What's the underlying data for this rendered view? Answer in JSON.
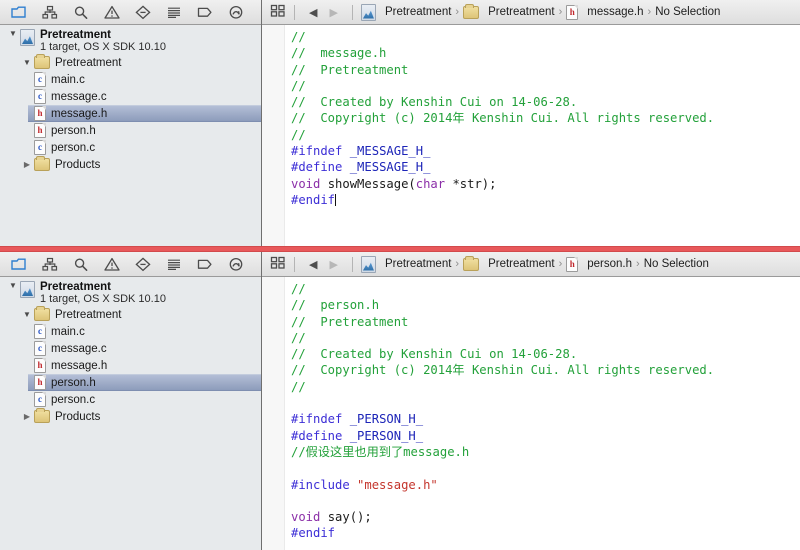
{
  "navigator": {
    "toolbar_icons": [
      {
        "name": "folder-navigator-icon",
        "active": true
      },
      {
        "name": "hierarchy-navigator-icon",
        "active": false
      },
      {
        "name": "search-navigator-icon",
        "active": false
      },
      {
        "name": "warning-navigator-icon",
        "active": false
      },
      {
        "name": "issue-navigator-icon",
        "active": false
      },
      {
        "name": "test-navigator-icon",
        "active": false
      },
      {
        "name": "breakpoint-navigator-icon",
        "active": false
      },
      {
        "name": "report-navigator-icon",
        "active": false
      }
    ],
    "project": {
      "name": "Pretreatment",
      "subtitle": "1 target, OS X SDK 10.10"
    },
    "group": {
      "name": "Pretreatment"
    },
    "files": [
      {
        "label": "main.c",
        "ext": "c"
      },
      {
        "label": "message.c",
        "ext": "c"
      },
      {
        "label": "message.h",
        "ext": "h"
      },
      {
        "label": "person.h",
        "ext": "h"
      },
      {
        "label": "person.c",
        "ext": "c"
      }
    ],
    "products": {
      "name": "Products"
    }
  },
  "top_pane": {
    "selected_file": "message.h",
    "jumpbar": {
      "back_arrow": "◀",
      "forward_arrow": "▶",
      "crumbs": [
        "Pretreatment",
        "Pretreatment",
        "message.h",
        "No Selection"
      ],
      "chevron": "›"
    },
    "code_lines": [
      [
        {
          "t": "//",
          "c": "cm"
        }
      ],
      [
        {
          "t": "//  message.h",
          "c": "cm"
        }
      ],
      [
        {
          "t": "//  Pretreatment",
          "c": "cm"
        }
      ],
      [
        {
          "t": "//",
          "c": "cm"
        }
      ],
      [
        {
          "t": "//  Created by Kenshin Cui on 14-06-28.",
          "c": "cm"
        }
      ],
      [
        {
          "t": "//  Copyright (c) 2014年 Kenshin Cui. All rights reserved.",
          "c": "cm"
        }
      ],
      [
        {
          "t": "//",
          "c": "cm"
        }
      ],
      [
        {
          "t": "#ifndef",
          "c": "pp"
        },
        {
          "t": " ",
          "c": "pl"
        },
        {
          "t": "_MESSAGE_H_",
          "c": "mac"
        }
      ],
      [
        {
          "t": "#define",
          "c": "pp"
        },
        {
          "t": " ",
          "c": "pl"
        },
        {
          "t": "_MESSAGE_H_",
          "c": "mac"
        }
      ],
      [
        {
          "t": "void",
          "c": "kw"
        },
        {
          "t": " showMessage(",
          "c": "pl"
        },
        {
          "t": "char",
          "c": "kw"
        },
        {
          "t": " *str);",
          "c": "pl"
        }
      ],
      [
        {
          "t": "#endif",
          "c": "pp"
        },
        {
          "t": "|CARET|",
          "c": "caret"
        }
      ]
    ]
  },
  "bottom_pane": {
    "selected_file": "person.h",
    "jumpbar": {
      "back_arrow": "◀",
      "forward_arrow": "▶",
      "crumbs": [
        "Pretreatment",
        "Pretreatment",
        "person.h",
        "No Selection"
      ],
      "chevron": "›"
    },
    "code_lines": [
      [
        {
          "t": "//",
          "c": "cm"
        }
      ],
      [
        {
          "t": "//  person.h",
          "c": "cm"
        }
      ],
      [
        {
          "t": "//  Pretreatment",
          "c": "cm"
        }
      ],
      [
        {
          "t": "//",
          "c": "cm"
        }
      ],
      [
        {
          "t": "//  Created by Kenshin Cui on 14-06-28.",
          "c": "cm"
        }
      ],
      [
        {
          "t": "//  Copyright (c) 2014年 Kenshin Cui. All rights reserved.",
          "c": "cm"
        }
      ],
      [
        {
          "t": "//",
          "c": "cm"
        }
      ],
      [
        {
          "t": "",
          "c": "pl"
        }
      ],
      [
        {
          "t": "#ifndef",
          "c": "pp"
        },
        {
          "t": " ",
          "c": "pl"
        },
        {
          "t": "_PERSON_H_",
          "c": "mac"
        }
      ],
      [
        {
          "t": "#define",
          "c": "pp"
        },
        {
          "t": " ",
          "c": "pl"
        },
        {
          "t": "_PERSON_H_",
          "c": "mac"
        }
      ],
      [
        {
          "t": "//假设这里也用到了message.h",
          "c": "cm"
        }
      ],
      [
        {
          "t": "",
          "c": "pl"
        }
      ],
      [
        {
          "t": "#include",
          "c": "pp"
        },
        {
          "t": " ",
          "c": "pl"
        },
        {
          "t": "\"message.h\"",
          "c": "str"
        }
      ],
      [
        {
          "t": "",
          "c": "pl"
        }
      ],
      [
        {
          "t": "void",
          "c": "kw"
        },
        {
          "t": " say();",
          "c": "pl"
        }
      ],
      [
        {
          "t": "#endif",
          "c": "pp"
        }
      ]
    ]
  },
  "colors": {
    "comment": "#23a13a",
    "preprocessor": "#3c2ed6",
    "macro": "#1d25b8",
    "keyword": "#8b2fa8",
    "string": "#c4352c",
    "divider_red": "#e8585a",
    "selection": "#8d9cbb"
  }
}
